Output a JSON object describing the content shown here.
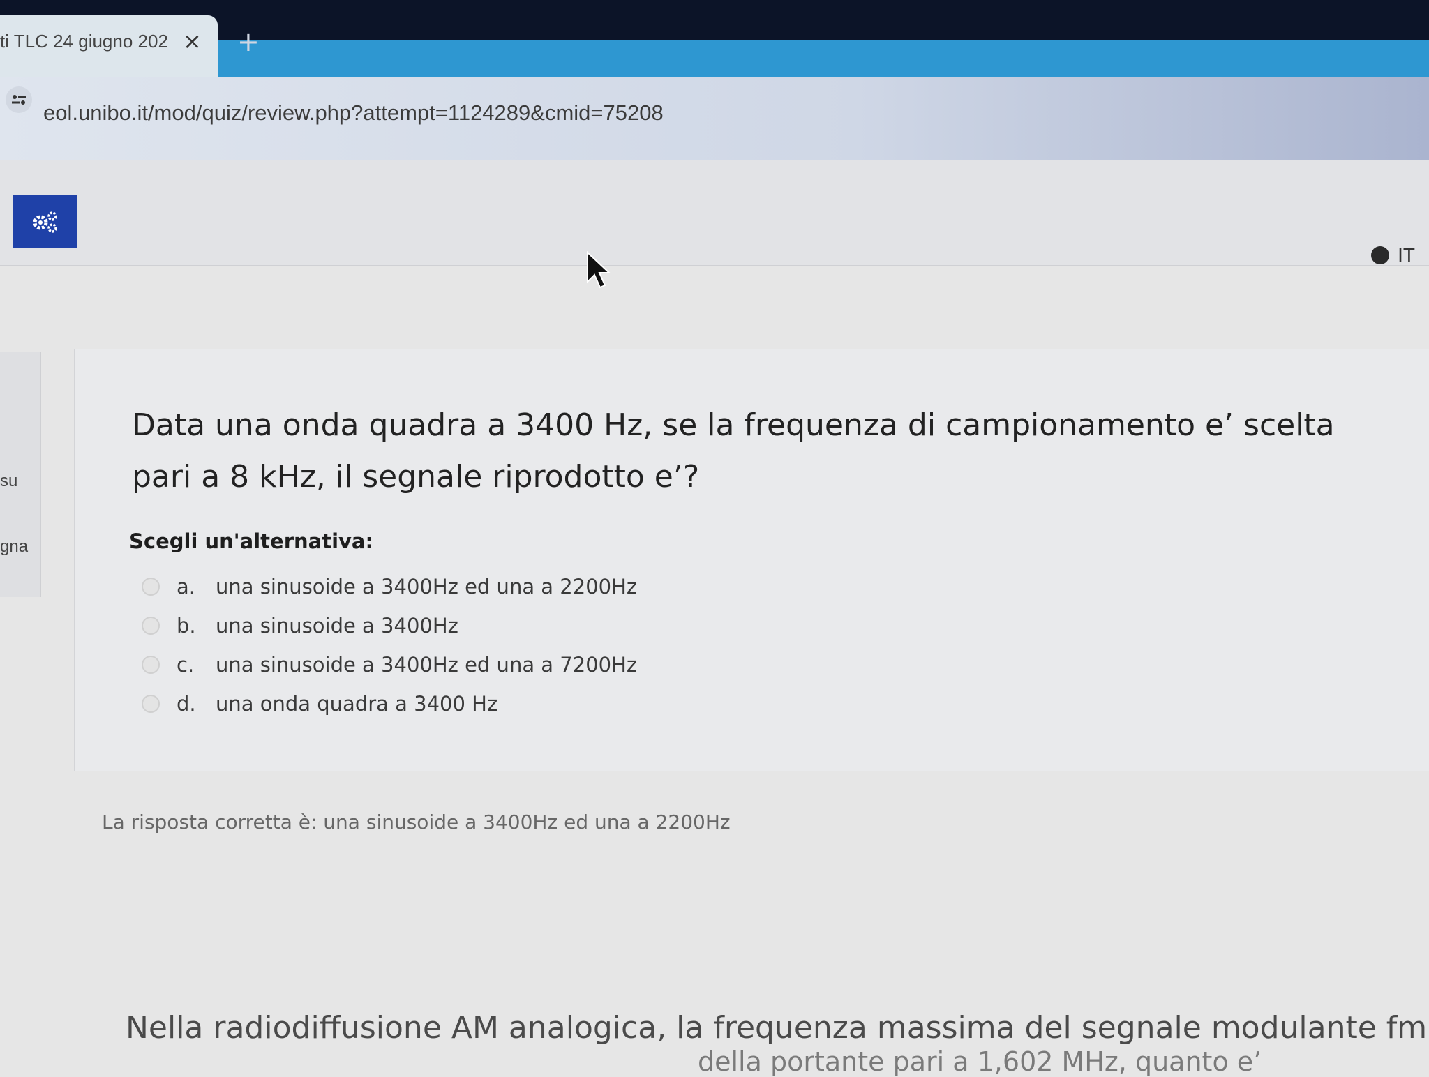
{
  "browser": {
    "tab_title": "ti TLC 24 giugno 202",
    "tab_close": "×",
    "new_tab": "+",
    "url": "eol.unibo.it/mod/quiz/review.php?attempt=1124289&cmid=75208"
  },
  "header": {
    "language": "IT"
  },
  "sidebar": {
    "fragment_1": "su",
    "fragment_2": "gna"
  },
  "question": {
    "text": "Data una onda quadra a 3400 Hz, se la frequenza di campionamento e’ scelta pari a 8 kHz, il segnale riprodotto e’?",
    "prompt": "Scegli un'alternativa:",
    "options": [
      {
        "letter": "a.",
        "text": "una sinusoide a 3400Hz ed una a 2200Hz"
      },
      {
        "letter": "b.",
        "text": "una sinusoide a 3400Hz"
      },
      {
        "letter": "c.",
        "text": "una sinusoide a 3400Hz ed una a 7200Hz"
      },
      {
        "letter": "d.",
        "text": "una onda quadra a 3400 Hz"
      }
    ],
    "correct_answer": "La risposta corretta è: una sinusoide a 3400Hz ed una a 2200Hz"
  },
  "next_question": {
    "text_line1": "Nella radiodiffusione AM analogica, la frequenza massima del segnale modulante fm e’",
    "text_line2": "della portante pari a 1,602 MHz, quanto e’"
  },
  "colors": {
    "settings_button": "#1f41a8",
    "tab_strip": "#2e97d1",
    "title_bar": "#0c1428"
  }
}
